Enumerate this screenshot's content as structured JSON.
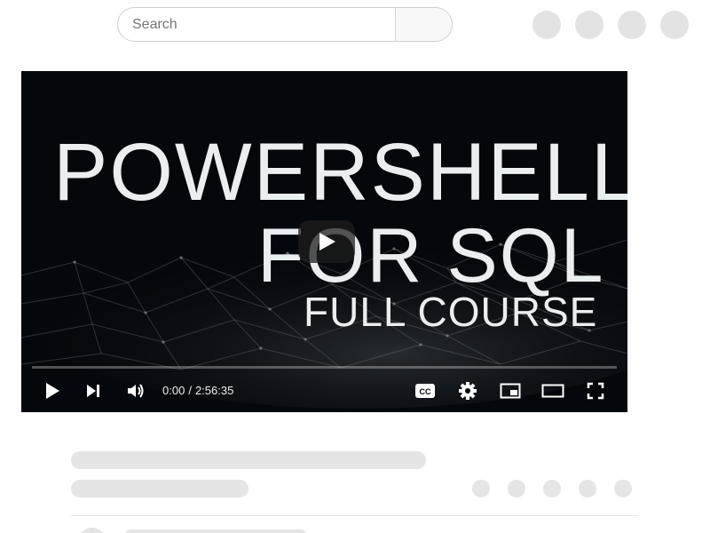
{
  "search": {
    "placeholder": "Search",
    "value": ""
  },
  "header": {
    "icons": [
      "header-icon-1",
      "header-icon-2",
      "header-icon-3",
      "header-icon-4"
    ]
  },
  "video": {
    "thumbnail_text": {
      "line1": "POWERSHELL",
      "line2": "FOR SQL",
      "line3": "FULL COURSE"
    },
    "current_time": "0:00",
    "separator": "/",
    "duration": "2:56:35",
    "progress": 0,
    "controls": {
      "play": "play-icon",
      "next": "next-icon",
      "volume": "volume-icon",
      "captions": "captions-icon",
      "settings": "gear-icon",
      "miniplayer": "miniplayer-icon",
      "theater": "theater-icon",
      "fullscreen": "fullscreen-icon"
    }
  },
  "colors": {
    "player_bg": "#04070b",
    "title_text": "#e9eef0",
    "skeleton": "#e5e5e5",
    "progress_fill": "#ff0000"
  }
}
